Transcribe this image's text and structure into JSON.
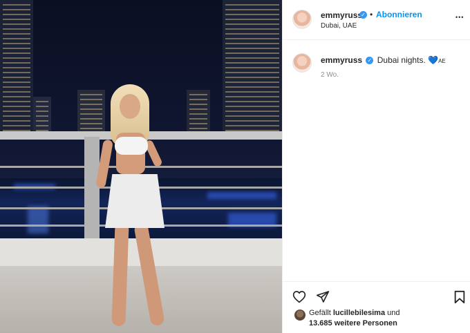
{
  "post": {
    "username": "emmyruss",
    "follow_label": "Abonnieren",
    "separator": "•",
    "location": "Dubai, UAE",
    "more_label": "•••",
    "caption_text": "Dubai nights.",
    "caption_heart": "💙",
    "caption_flag": "AE",
    "time_ago": "2 Wo.",
    "verified_mark": "✓"
  },
  "likes": {
    "prefix": "Gefällt",
    "user": "lucillebilesima",
    "joiner": "und",
    "count_text": "13.685 weitere Personen"
  },
  "icons": {
    "like": "heart-outline-icon",
    "share": "paper-plane-icon",
    "save": "bookmark-icon",
    "verified": "verified-badge-icon"
  },
  "colors": {
    "accent": "#0095f6",
    "verified": "#3897f0",
    "text": "#262626",
    "muted": "#8e8e8e"
  }
}
